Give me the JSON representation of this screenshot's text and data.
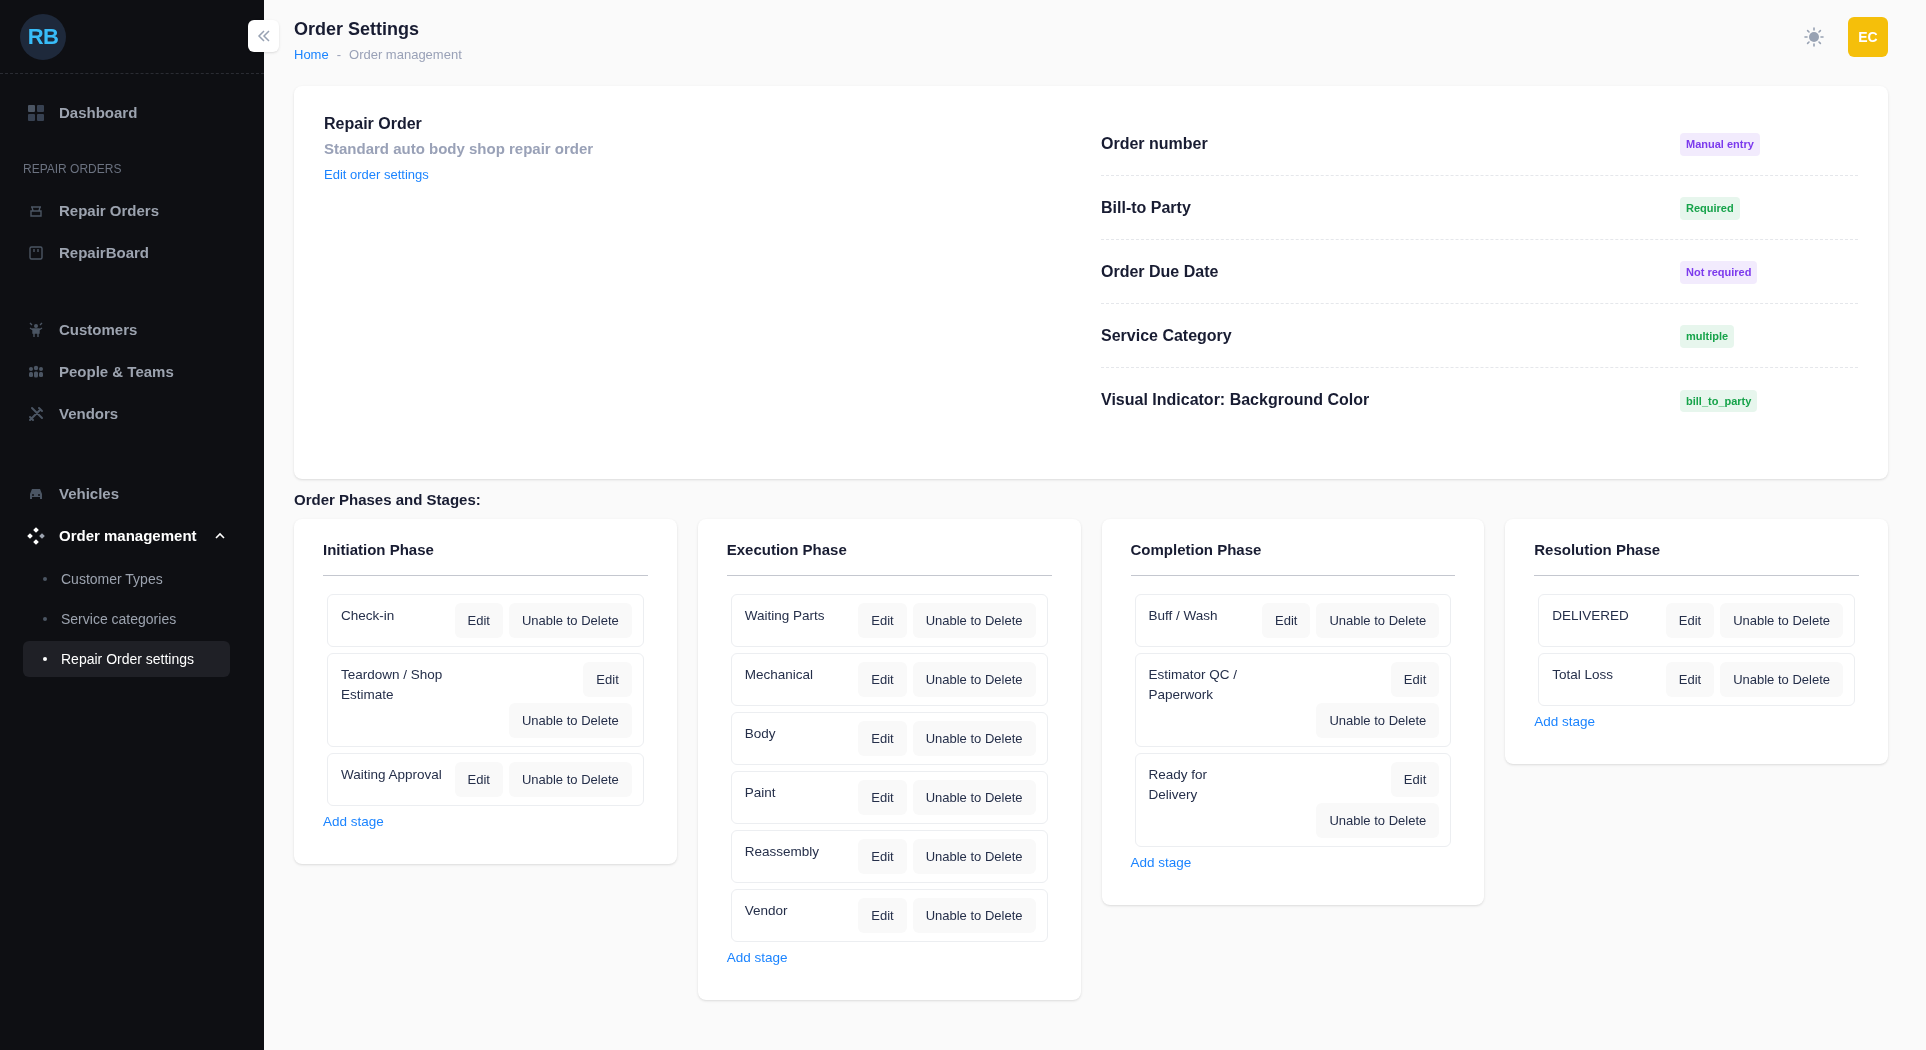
{
  "logo": {
    "text": "RB"
  },
  "sidebar": {
    "groups": [
      {
        "items": [
          {
            "label": "Dashboard"
          }
        ]
      },
      {
        "label": "REPAIR ORDERS",
        "items": [
          {
            "label": "Repair Orders"
          },
          {
            "label": "RepairBoard"
          }
        ]
      },
      {
        "items": [
          {
            "label": "Customers"
          },
          {
            "label": "People & Teams"
          },
          {
            "label": "Vendors"
          }
        ]
      },
      {
        "items": [
          {
            "label": "Vehicles"
          },
          {
            "label": "Order management",
            "expanded": true,
            "children": [
              {
                "label": "Customer Types",
                "selected": false
              },
              {
                "label": "Service categories",
                "selected": false
              },
              {
                "label": "Repair Order settings",
                "selected": true
              }
            ]
          }
        ]
      }
    ]
  },
  "header": {
    "title": "Order Settings",
    "breadcrumb": [
      {
        "label": "Home",
        "link": true
      },
      {
        "label": "-",
        "link": false
      },
      {
        "label": "Order management",
        "link": false
      }
    ],
    "avatar": "EC"
  },
  "order": {
    "title": "Repair Order",
    "description": "Standard auto body shop repair order",
    "link": "Edit order settings",
    "settings": [
      {
        "label": "Order number",
        "badge": "Manual entry",
        "color": "#7c3aed"
      },
      {
        "label": "Bill-to Party",
        "badge": "Required",
        "color": "#16a34a"
      },
      {
        "label": "Order Due Date",
        "badge": "Not required",
        "color": "#7c3aed"
      },
      {
        "label": "Service Category",
        "badge": "multiple",
        "color": "#16a34a"
      },
      {
        "label": "Visual Indicator: Background Color",
        "badge": "bill_to_party",
        "color": "#16a34a"
      }
    ]
  },
  "phases_heading": "Order Phases and Stages:",
  "phases": [
    {
      "title": "Initiation Phase",
      "add": "Add stage",
      "stages": [
        {
          "label": "Check-in",
          "buttons": [
            "Edit",
            "Unable to Delete"
          ]
        },
        {
          "label": "Teardown / Shop Estimate",
          "buttons": [
            "Edit",
            "Unable to Delete"
          ]
        },
        {
          "label": "Waiting Approval",
          "buttons": [
            "Edit",
            "Unable to Delete"
          ]
        }
      ]
    },
    {
      "title": "Execution Phase",
      "add": "Add stage",
      "stages": [
        {
          "label": "Waiting Parts",
          "buttons": [
            "Edit",
            "Unable to Delete"
          ]
        },
        {
          "label": "Mechanical",
          "buttons": [
            "Edit",
            "Unable to Delete"
          ]
        },
        {
          "label": "Body",
          "buttons": [
            "Edit",
            "Unable to Delete"
          ]
        },
        {
          "label": "Paint",
          "buttons": [
            "Edit",
            "Unable to Delete"
          ]
        },
        {
          "label": "Reassembly",
          "buttons": [
            "Edit",
            "Unable to Delete"
          ]
        },
        {
          "label": "Vendor",
          "buttons": [
            "Edit",
            "Unable to Delete"
          ]
        }
      ]
    },
    {
      "title": "Completion Phase",
      "add": "Add stage",
      "stages": [
        {
          "label": "Buff / Wash",
          "buttons": [
            "Edit",
            "Unable to Delete"
          ]
        },
        {
          "label": "Estimator QC / Paperwork",
          "buttons": [
            "Edit",
            "Unable to Delete"
          ]
        },
        {
          "label": "Ready for Delivery",
          "buttons": [
            "Edit",
            "Unable to Delete"
          ]
        }
      ]
    },
    {
      "title": "Resolution Phase",
      "add": "Add stage",
      "stages": [
        {
          "label": "DELIVERED",
          "buttons": [
            "Edit",
            "Unable to Delete"
          ]
        },
        {
          "label": "Total Loss",
          "buttons": [
            "Edit",
            "Unable to Delete"
          ]
        }
      ]
    }
  ]
}
